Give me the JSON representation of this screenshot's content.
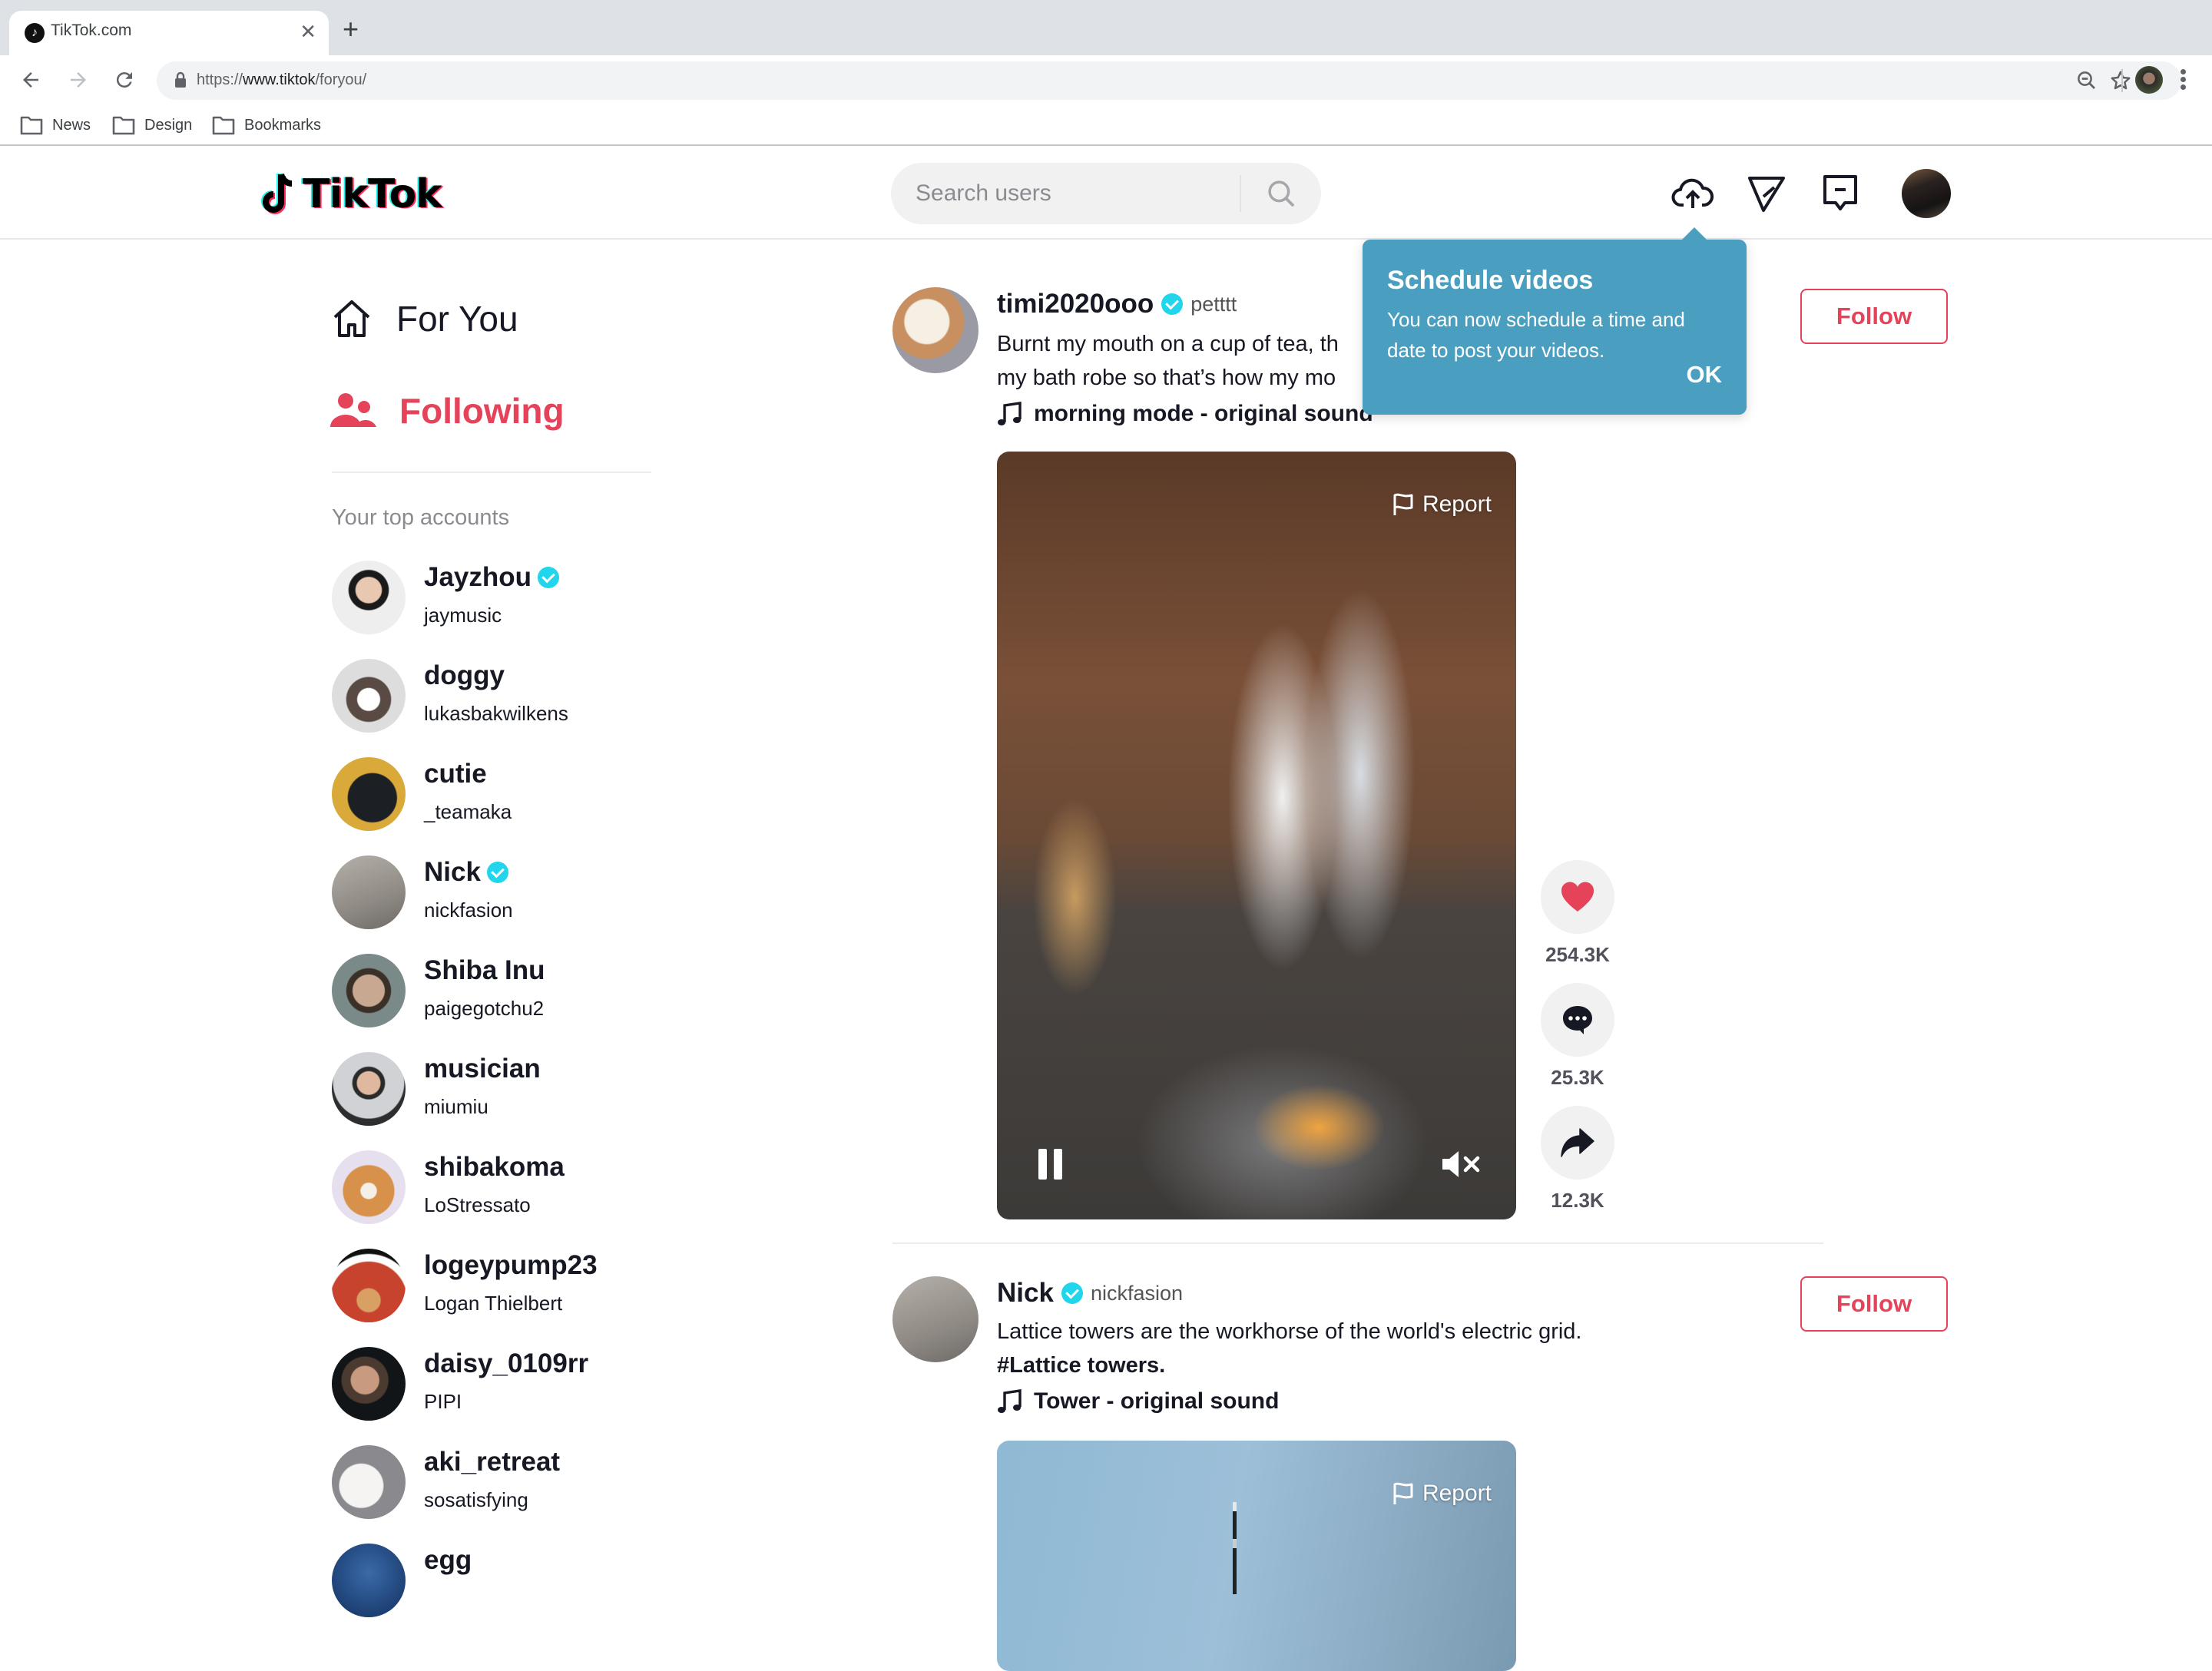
{
  "browser": {
    "tab_title": "TikTok.com",
    "url_prefix": "https://",
    "url_host": "www.tiktok",
    "url_path": "/foryou/",
    "bookmarks": [
      {
        "label": "News",
        "icon": "folder-icon"
      },
      {
        "label": "Design",
        "icon": "folder-icon"
      },
      {
        "label": "Bookmarks",
        "icon": "folder-icon"
      }
    ]
  },
  "header": {
    "logo_text": "TikTok",
    "search_placeholder": "Search users",
    "icons": [
      "upload-cloud-icon",
      "send-icon",
      "inbox-icon",
      "profile-avatar"
    ]
  },
  "sidebar": {
    "nav": [
      {
        "label": "For You",
        "icon": "home-icon",
        "active": false
      },
      {
        "label": "Following",
        "icon": "users-icon",
        "active": true
      }
    ],
    "section_title": "Your top accounts",
    "accounts": [
      {
        "name": "Jayzhou",
        "username": "jaymusic",
        "verified": true
      },
      {
        "name": "doggy",
        "username": "lukasbakwilkens",
        "verified": false
      },
      {
        "name": "cutie",
        "username": "_teamaka",
        "verified": false
      },
      {
        "name": "Nick",
        "username": "nickfasion",
        "verified": true
      },
      {
        "name": "Shiba Inu",
        "username": "paigegotchu2",
        "verified": false
      },
      {
        "name": "musician",
        "username": "miumiu",
        "verified": false
      },
      {
        "name": "shibakoma",
        "username": "LoStressato",
        "verified": false
      },
      {
        "name": "logeypump23",
        "username": "Logan Thielbert",
        "verified": false
      },
      {
        "name": "daisy_0109rr",
        "username": "PIPI",
        "verified": false
      },
      {
        "name": "aki_retreat",
        "username": "sosatisfying",
        "verified": false
      },
      {
        "name": "egg",
        "username": "",
        "verified": false
      }
    ]
  },
  "tooltip": {
    "title": "Schedule videos",
    "body": "You can now schedule a time and date to post your videos.",
    "ok_label": "OK"
  },
  "posts": [
    {
      "username": "timi2020ooo",
      "verified": true,
      "handle": "petttt",
      "caption_line1": "Burnt my mouth on a cup of tea, th",
      "caption_line2": "my bath robe so that’s how my mo",
      "music": "morning mode - original sound",
      "follow_label": "Follow",
      "report_label": "Report",
      "likes": "254.3K",
      "comments": "25.3K",
      "shares": "12.3K"
    },
    {
      "username": "Nick",
      "verified": true,
      "handle": "nickfasion",
      "caption_line1": "Lattice towers are the workhorse of the world's electric grid.",
      "caption_line2": "#Lattice towers.",
      "music": "Tower - original sound",
      "follow_label": "Follow",
      "report_label": "Report"
    }
  ],
  "colors": {
    "brand_red": "#e4435a",
    "verified_blue": "#20d5ec",
    "tooltip_bg": "#4a9fc0"
  }
}
